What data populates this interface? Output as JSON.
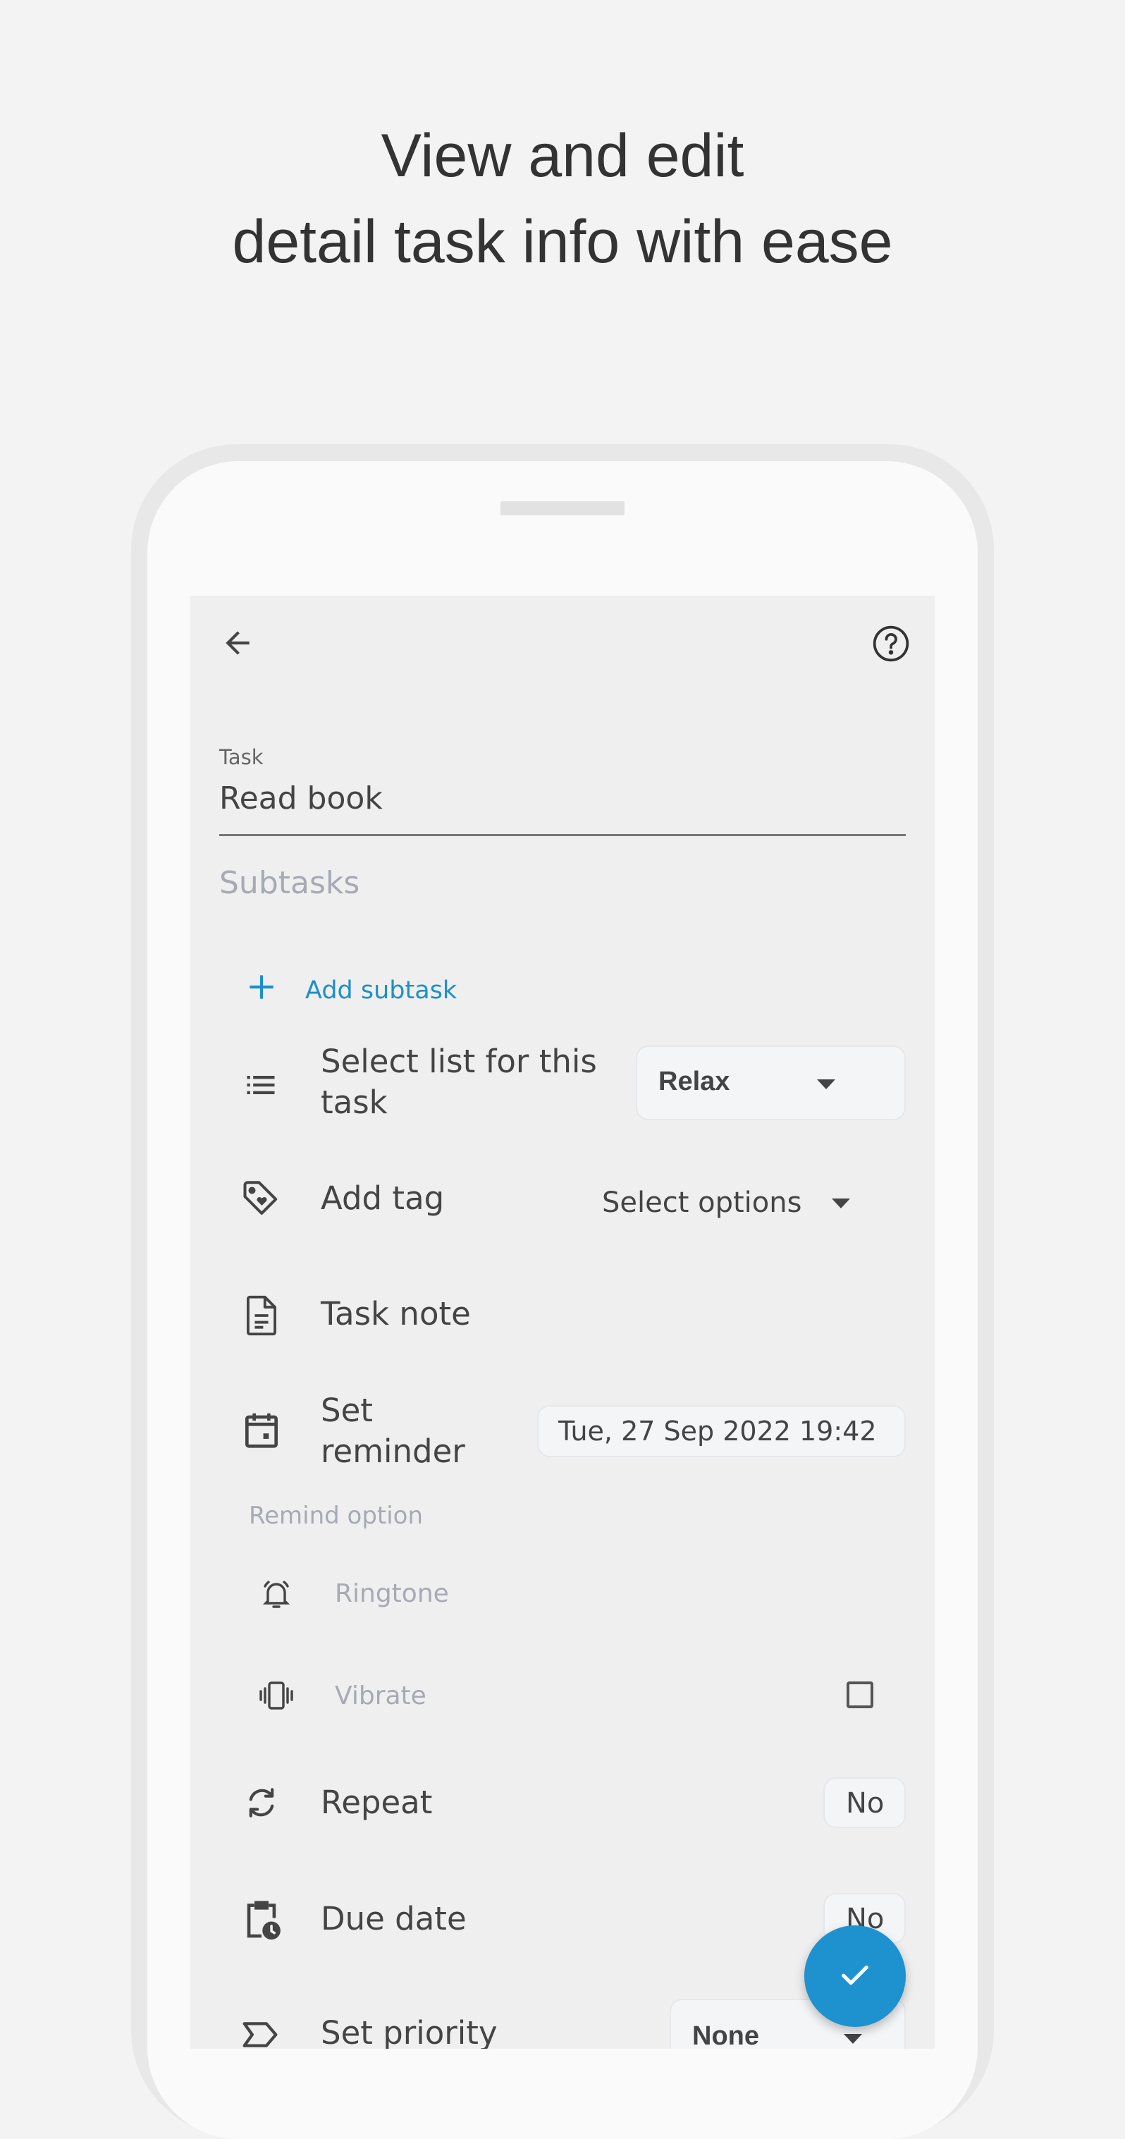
{
  "headline": {
    "line1": "View and edit",
    "line2": "detail task info with ease"
  },
  "form": {
    "task_label": "Task",
    "task_value": "Read book",
    "subtasks_heading": "Subtasks",
    "add_subtask": "Add subtask",
    "list_label_line1": "Select list for this",
    "list_label_line2": "task",
    "list_value": "Relax",
    "tag_label": "Add tag",
    "tag_value": "Select options",
    "note_label": "Task note",
    "reminder_label_line1": "Set",
    "reminder_label_line2": "reminder",
    "reminder_value": "Tue, 27 Sep 2022 19:42",
    "remind_option_heading": "Remind option",
    "ringtone_label": "Ringtone",
    "vibrate_label": "Vibrate",
    "vibrate_checked": false,
    "repeat_label": "Repeat",
    "repeat_value": "No",
    "due_label": "Due date",
    "due_value": "No",
    "priority_label": "Set priority",
    "priority_value": "None"
  },
  "icons": {
    "back": "arrow-left-icon",
    "help": "help-circle-icon",
    "add": "plus-icon",
    "list": "list-icon",
    "tag": "tag-heart-icon",
    "note": "document-icon",
    "reminder": "calendar-icon",
    "ringtone": "bell-ringing-icon",
    "vibrate": "vibrate-icon",
    "repeat": "repeat-icon",
    "due": "clipboard-clock-icon",
    "priority": "priority-label-icon",
    "confirm": "check-icon"
  },
  "colors": {
    "accent": "#1e91cf",
    "muted_text": "#a7aab4",
    "screen_bg": "#efefef"
  }
}
